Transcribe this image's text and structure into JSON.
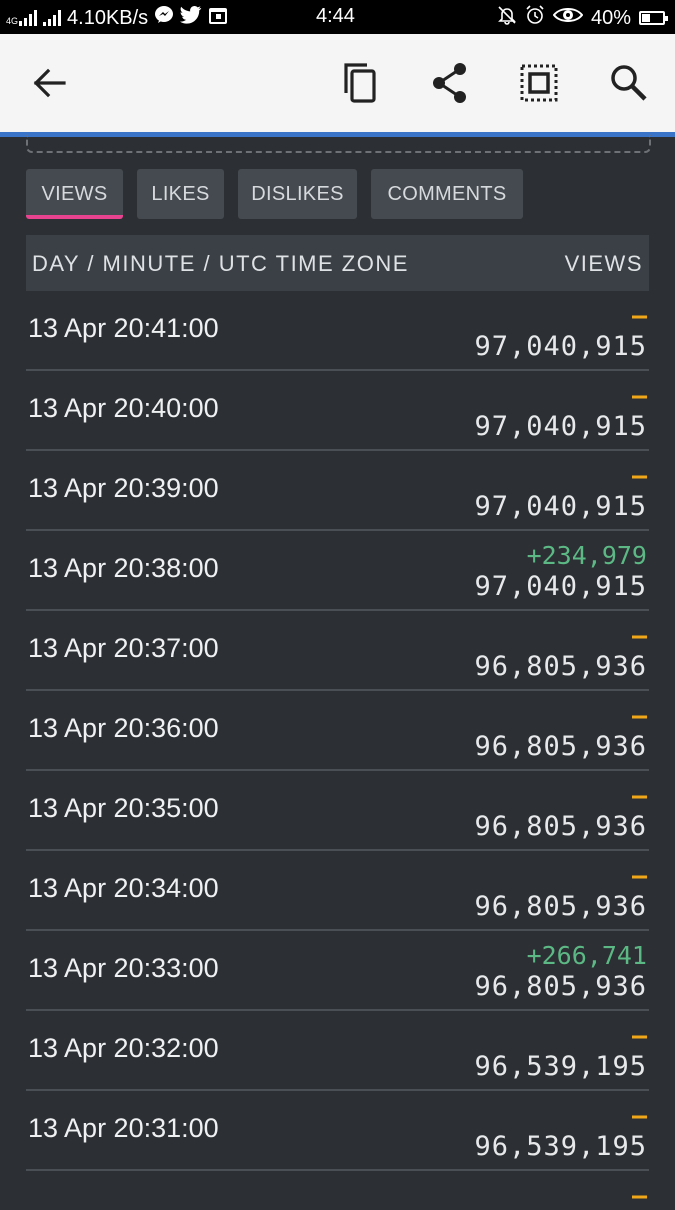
{
  "status_bar": {
    "network_speed": "4.10KB/s",
    "clock": "4:44",
    "battery": "40%",
    "battery_level": 0.4,
    "left_icons": [
      "4g-signal-icon",
      "signal-icon",
      "messenger-icon",
      "twitter-icon",
      "calendar-icon"
    ],
    "right_icons": [
      "bell-off-icon",
      "alarm-icon",
      "eye-icon"
    ]
  },
  "app_bar": {
    "icons": [
      "back-arrow-icon",
      "copy-icon",
      "share-icon",
      "select-all-icon",
      "search-icon"
    ]
  },
  "tabs": [
    {
      "label": "VIEWS",
      "active": true
    },
    {
      "label": "LIKES",
      "active": false
    },
    {
      "label": "DISLIKES",
      "active": false
    },
    {
      "label": "COMMENTS",
      "active": false
    }
  ],
  "table": {
    "col_time": "DAY / MINUTE / UTC TIME ZONE",
    "col_views": "VIEWS",
    "rows": [
      {
        "time": "13 Apr 20:41:00",
        "delta": "–",
        "views": "97,040,915"
      },
      {
        "time": "13 Apr 20:40:00",
        "delta": "–",
        "views": "97,040,915"
      },
      {
        "time": "13 Apr 20:39:00",
        "delta": "–",
        "views": "97,040,915"
      },
      {
        "time": "13 Apr 20:38:00",
        "delta": "+234,979",
        "views": "97,040,915"
      },
      {
        "time": "13 Apr 20:37:00",
        "delta": "–",
        "views": "96,805,936"
      },
      {
        "time": "13 Apr 20:36:00",
        "delta": "–",
        "views": "96,805,936"
      },
      {
        "time": "13 Apr 20:35:00",
        "delta": "–",
        "views": "96,805,936"
      },
      {
        "time": "13 Apr 20:34:00",
        "delta": "–",
        "views": "96,805,936"
      },
      {
        "time": "13 Apr 20:33:00",
        "delta": "+266,741",
        "views": "96,805,936"
      },
      {
        "time": "13 Apr 20:32:00",
        "delta": "–",
        "views": "96,539,195"
      },
      {
        "time": "13 Apr 20:31:00",
        "delta": "–",
        "views": "96,539,195"
      }
    ],
    "partial_row": {
      "delta": "–"
    }
  },
  "colors": {
    "accent_blue": "#3a74c9",
    "tab_indicator": "#e8438f",
    "delta_positive": "#5cb884",
    "delta_none": "#f0a81a"
  }
}
